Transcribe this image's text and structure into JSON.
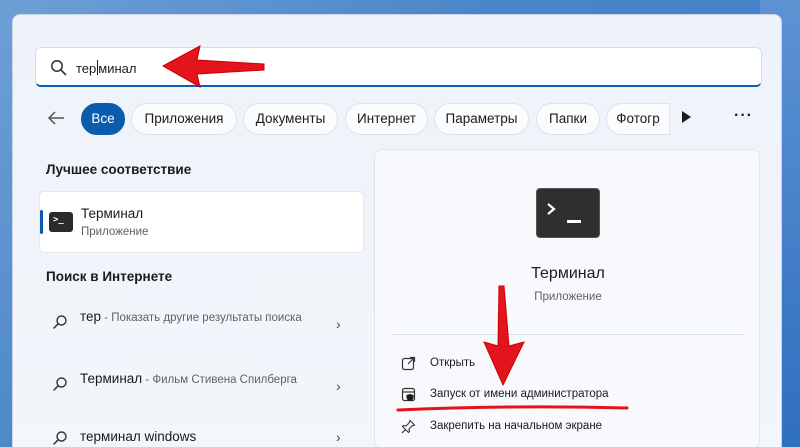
{
  "search": {
    "value_typed": "тер",
    "value_rest": "минал"
  },
  "filters": {
    "chips": [
      "Все",
      "Приложения",
      "Документы",
      "Интернет",
      "Параметры",
      "Папки",
      "Фотогр"
    ]
  },
  "best_match": {
    "heading": "Лучшее соответствие",
    "name": "Терминал",
    "type": "Приложение"
  },
  "web_search": {
    "heading": "Поиск в Интернете",
    "items": [
      {
        "term": "тер",
        "desc": " - Показать другие результаты поиска"
      },
      {
        "term": "Терминал",
        "desc": " - Фильм Стивена Спилберга"
      },
      {
        "term": "терминал windows",
        "desc": ""
      }
    ]
  },
  "detail": {
    "title": "Терминал",
    "subtitle": "Приложение",
    "actions": [
      "Открыть",
      "Запуск от имени администратора",
      "Закрепить на начальном экране"
    ]
  },
  "colors": {
    "accent": "#0b5cad",
    "annotation": "#e3141b"
  }
}
